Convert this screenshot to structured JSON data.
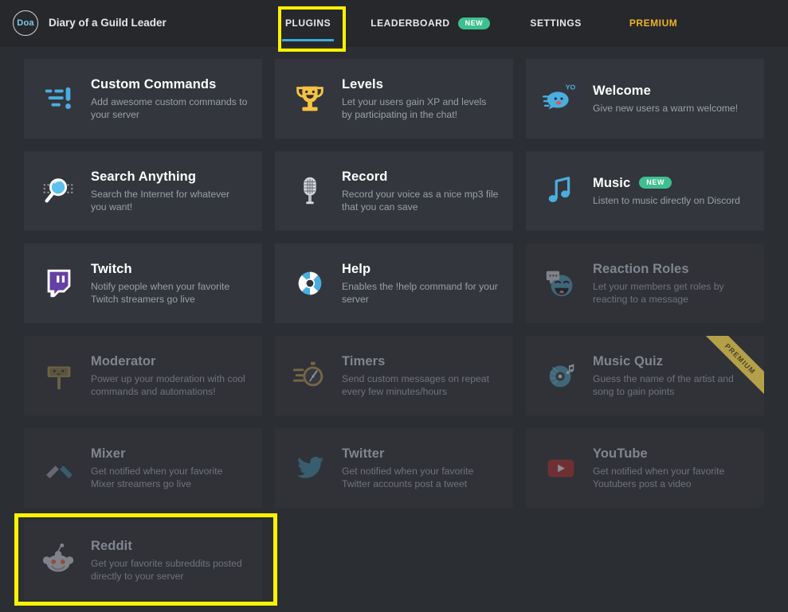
{
  "header": {
    "logo_text": "Doa",
    "brand_name": "Diary of a Guild Leader",
    "nav": [
      {
        "label": "PLUGINS",
        "active": true,
        "badge": "",
        "style": "default"
      },
      {
        "label": "LEADERBOARD",
        "active": false,
        "badge": "NEW",
        "style": "default"
      },
      {
        "label": "SETTINGS",
        "active": false,
        "badge": "",
        "style": "default"
      },
      {
        "label": "PREMIUM",
        "active": false,
        "badge": "",
        "style": "premium"
      }
    ]
  },
  "colors": {
    "page_bg": "#2b2e33",
    "header_bg": "#26282c",
    "card_bg": "#33363c",
    "card_bg_dim": "#303238",
    "accent_blue": "#3fa9dd",
    "badge_green": "#3fbf8f",
    "premium_gold": "#f0b323",
    "highlight_yellow": "#fff200",
    "ribbon_gold": "#b5a04a"
  },
  "annotations": {
    "plugins_tab_highlight": "PLUGINS",
    "reddit_card_highlight": "Reddit"
  },
  "plugins": [
    {
      "name": "Custom Commands",
      "description": "Add awesome custom commands to your server",
      "icon": "custom-commands-icon",
      "enabled": true,
      "badge": "",
      "premium": false
    },
    {
      "name": "Levels",
      "description": "Let your users gain XP and levels by participating in the chat!",
      "icon": "trophy-icon",
      "enabled": true,
      "badge": "",
      "premium": false
    },
    {
      "name": "Welcome",
      "description": "Give new users a warm welcome!",
      "icon": "welcome-speech-bubble-icon",
      "enabled": true,
      "badge": "",
      "premium": false
    },
    {
      "name": "Search Anything",
      "description": "Search the Internet for whatever you want!",
      "icon": "magnifier-icon",
      "enabled": true,
      "badge": "",
      "premium": false
    },
    {
      "name": "Record",
      "description": "Record your voice as a nice mp3 file that you can save",
      "icon": "microphone-icon",
      "enabled": true,
      "badge": "",
      "premium": false
    },
    {
      "name": "Music",
      "description": "Listen to music directly on Discord",
      "icon": "music-note-icon",
      "enabled": true,
      "badge": "NEW",
      "premium": false
    },
    {
      "name": "Twitch",
      "description": "Notify people when your favorite Twitch streamers go live",
      "icon": "twitch-icon",
      "enabled": true,
      "badge": "",
      "premium": false
    },
    {
      "name": "Help",
      "description": "Enables the !help command for your server",
      "icon": "lifebuoy-icon",
      "enabled": true,
      "badge": "",
      "premium": false
    },
    {
      "name": "Reaction Roles",
      "description": "Let your members get roles by reacting to a message",
      "icon": "smiley-reaction-icon",
      "enabled": false,
      "badge": "",
      "premium": false
    },
    {
      "name": "Moderator",
      "description": "Power up your moderation with cool commands and automations!",
      "icon": "gavel-hammer-icon",
      "enabled": false,
      "badge": "",
      "premium": false
    },
    {
      "name": "Timers",
      "description": "Send custom messages on repeat every few minutes/hours",
      "icon": "stopwatch-icon",
      "enabled": false,
      "badge": "",
      "premium": false
    },
    {
      "name": "Music Quiz",
      "description": "Guess the name of the artist and song to gain points",
      "icon": "vinyl-disc-icon",
      "enabled": false,
      "badge": "",
      "premium": true,
      "premium_label": "PREMIUM"
    },
    {
      "name": "Mixer",
      "description": "Get notified when your favorite Mixer streamers go live",
      "icon": "mixer-icon",
      "enabled": false,
      "badge": "",
      "premium": false
    },
    {
      "name": "Twitter",
      "description": "Get notified when your favorite Twitter accounts post a tweet",
      "icon": "twitter-bird-icon",
      "enabled": false,
      "badge": "",
      "premium": false
    },
    {
      "name": "YouTube",
      "description": "Get notified when your favorite Youtubers post a video",
      "icon": "youtube-icon",
      "enabled": false,
      "badge": "",
      "premium": false
    },
    {
      "name": "Reddit",
      "description": "Get your favorite subreddits posted directly to your server",
      "icon": "reddit-alien-icon",
      "enabled": false,
      "badge": "",
      "premium": false
    }
  ]
}
